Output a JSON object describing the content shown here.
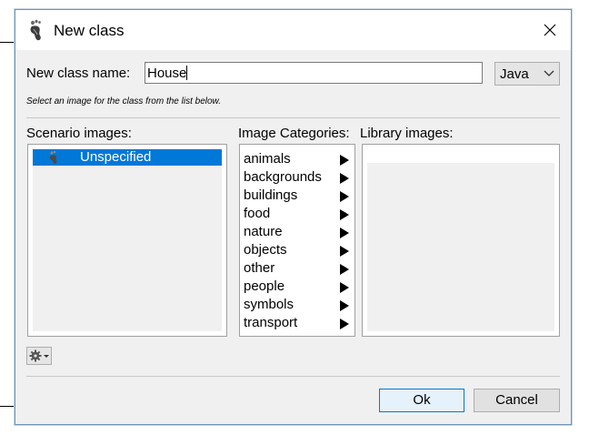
{
  "window": {
    "title": "New class"
  },
  "form": {
    "name_label": "New class name:",
    "name_value": "House",
    "language": "Java",
    "hint": "Select an image for the class from the list below."
  },
  "scenario": {
    "label": "Scenario images:",
    "items": [
      {
        "label": "Unspecified",
        "selected": true
      }
    ]
  },
  "categories": {
    "label": "Image Categories:",
    "items": [
      "animals",
      "backgrounds",
      "buildings",
      "food",
      "nature",
      "objects",
      "other",
      "people",
      "symbols",
      "transport"
    ]
  },
  "library": {
    "label": "Library images:"
  },
  "buttons": {
    "ok": "Ok",
    "cancel": "Cancel"
  },
  "colors": {
    "selection": "#0078d7",
    "dialog_bg": "#f0f0f0",
    "ok_border": "#0078d7"
  }
}
